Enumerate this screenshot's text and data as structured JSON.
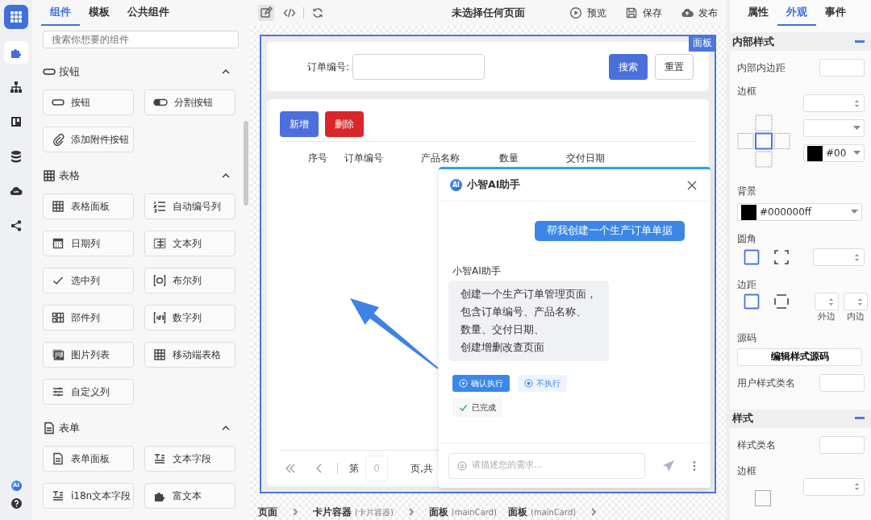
{
  "rail": {
    "items": [
      {
        "selected": true
      },
      {
        "selected": false
      },
      {
        "selected": false
      },
      {
        "selected": false
      },
      {
        "selected": false
      },
      {
        "selected": false
      }
    ],
    "badge": "AI"
  },
  "component_panel": {
    "tabs": [
      {
        "label": "组件",
        "selected": true
      },
      {
        "label": "模板",
        "selected": false
      },
      {
        "label": "公共组件",
        "selected": false
      }
    ],
    "search": {
      "placeholder": "搜索你想要的组件"
    },
    "sections": [
      {
        "title": "按钮",
        "expanded": true,
        "items": [
          "按钮",
          "分割按钮",
          "添加附件按钮"
        ]
      },
      {
        "title": "表格",
        "expanded": true,
        "items": [
          "表格面板",
          "自动编号列",
          "日期列",
          "文本列",
          "选中列",
          "布尔列",
          "部件列",
          "数字列",
          "图片列表",
          "移动端表格",
          "自定义列"
        ]
      },
      {
        "title": "表单",
        "expanded": true,
        "items": [
          "表单面板",
          "文本字段",
          "i18n文本字段",
          "富文本"
        ]
      }
    ]
  },
  "toolbar": {
    "tools": [
      {
        "selected": true
      },
      {
        "selected": false
      },
      {
        "selected": false
      }
    ],
    "title": "未选择任何页面",
    "actions": [
      "预览",
      "保存",
      "发布"
    ]
  },
  "canvas": {
    "panel_tag": "面板",
    "search_form": {
      "label": "订单编号:",
      "buttons": [
        {
          "label": "搜索",
          "kind": "primary"
        },
        {
          "label": "重置",
          "kind": "default"
        }
      ]
    },
    "table": {
      "buttons": [
        {
          "label": "新增",
          "kind": "primary"
        },
        {
          "label": "删除",
          "kind": "danger"
        }
      ],
      "columns": [
        "序号",
        "订单编号",
        "产品名称",
        "数量",
        "交付日期"
      ],
      "pager": {
        "prefix": "第",
        "page": "0",
        "suffix": "页,共"
      }
    }
  },
  "chat": {
    "logo": "AI",
    "title": "小智AI助手",
    "messages": [
      {
        "kind": "user",
        "text": "帮我创建一个生产订单单据"
      },
      {
        "kind": "assistant",
        "sender": "小智AI助手",
        "lines": [
          "创建一个生产订单管理页面，",
          "包含订单编号、产品名称、",
          "数量、交付日期、",
          "创建增删改查页面"
        ]
      }
    ],
    "actions": [
      {
        "label": "确认执行",
        "kind": "primary"
      },
      {
        "label": "不执行",
        "kind": "secondary"
      }
    ],
    "status": "已完成",
    "input": {
      "placeholder": "请描述您的需求..."
    }
  },
  "breadcrumb": [
    {
      "label": "页面",
      "separator": true
    },
    {
      "label": "卡片容器",
      "note": "(卡片容器)",
      "separator": true
    },
    {
      "label": "面板",
      "note": "(mainCard)",
      "separator": false
    },
    {
      "label": "面板",
      "note": "(mainCard)",
      "separator": true
    }
  ],
  "properties": {
    "tabs": [
      {
        "label": "属性",
        "selected": false
      },
      {
        "label": "外观",
        "selected": true
      },
      {
        "label": "事件",
        "selected": false
      }
    ],
    "sections": [
      {
        "title": "内部样式",
        "expanded": true,
        "rows": [
          {
            "kind": "input",
            "label": "内部内边距"
          },
          {
            "kind": "border",
            "label": "边框",
            "color_value": "#00"
          },
          {
            "kind": "color",
            "label": "背景",
            "value": "#000000ff"
          },
          {
            "kind": "radius",
            "label": "圆角"
          },
          {
            "kind": "spacing",
            "label": "边距",
            "captions": [
              "外边",
              "内边"
            ]
          },
          {
            "kind": "button",
            "label": "源码",
            "button": "编辑样式源码"
          },
          {
            "kind": "input",
            "label": "用户样式类名"
          }
        ]
      },
      {
        "title": "样式",
        "expanded": true,
        "rows": [
          {
            "kind": "input",
            "label": "样式类名"
          },
          {
            "kind": "border_cut",
            "label": "边框"
          }
        ]
      }
    ]
  }
}
